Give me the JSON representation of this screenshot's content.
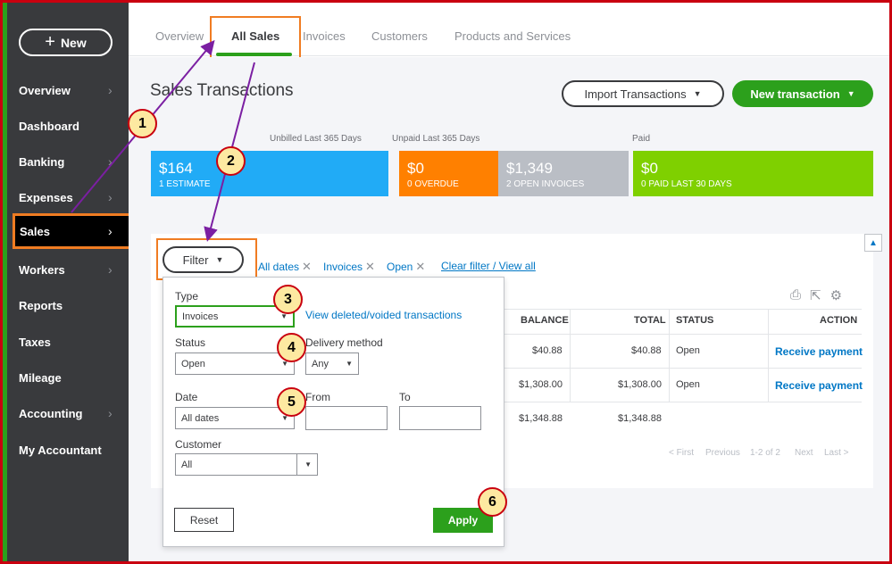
{
  "sidebar": {
    "new_label": "New",
    "items": [
      {
        "label": "Overview",
        "has_chevron": true
      },
      {
        "label": "Dashboard",
        "has_chevron": false
      },
      {
        "label": "Banking",
        "has_chevron": true
      },
      {
        "label": "Expenses",
        "has_chevron": true
      },
      {
        "label": "Sales",
        "has_chevron": true,
        "active": true
      },
      {
        "label": "Workers",
        "has_chevron": true
      },
      {
        "label": "Reports",
        "has_chevron": false
      },
      {
        "label": "Taxes",
        "has_chevron": false
      },
      {
        "label": "Mileage",
        "has_chevron": false
      },
      {
        "label": "Accounting",
        "has_chevron": true
      },
      {
        "label": "My Accountant",
        "has_chevron": false
      }
    ]
  },
  "tabs": [
    "Overview",
    "All Sales",
    "Invoices",
    "Customers",
    "Products and Services"
  ],
  "active_tab": "All Sales",
  "page": {
    "title": "Sales Transactions",
    "import_label": "Import Transactions",
    "new_transaction_label": "New transaction"
  },
  "money_bar": {
    "unbilled_label": "Unbilled Last 365 Days",
    "unpaid_label": "Unpaid Last 365 Days",
    "paid_label": "Paid",
    "estimate": {
      "amount": "$164",
      "sub": "1 ESTIMATE",
      "color": "#21abf6"
    },
    "overdue": {
      "amount": "$0",
      "sub": "0 OVERDUE",
      "color": "#ff8000"
    },
    "open_invoices": {
      "amount": "$1,349",
      "sub": "2 OPEN INVOICES",
      "color": "#babec5"
    },
    "paid": {
      "amount": "$0",
      "sub": "0 PAID LAST 30 DAYS",
      "color": "#7fd000"
    }
  },
  "filter_bar": {
    "filter_label": "Filter",
    "chips": [
      "All dates",
      "Invoices",
      "Open"
    ],
    "clear_label": "Clear filter / View all"
  },
  "filter_panel": {
    "type_label": "Type",
    "type_value": "Invoices",
    "view_deleted_label": "View deleted/voided transactions",
    "status_label": "Status",
    "status_value": "Open",
    "delivery_label": "Delivery method",
    "delivery_value": "Any",
    "date_label": "Date",
    "date_value": "All dates",
    "from_label": "From",
    "to_label": "To",
    "customer_label": "Customer",
    "customer_value": "All",
    "reset_label": "Reset",
    "apply_label": "Apply"
  },
  "table": {
    "headers": {
      "balance": "BALANCE",
      "total": "TOTAL",
      "status": "STATUS",
      "action": "ACTION"
    },
    "rows": [
      {
        "balance": "$40.88",
        "total": "$40.88",
        "status": "Open",
        "action": "Receive payment"
      },
      {
        "balance": "$1,308.00",
        "total": "$1,308.00",
        "status": "Open",
        "action": "Receive payment"
      }
    ],
    "totals": {
      "balance": "$1,348.88",
      "total": "$1,348.88"
    },
    "pagination": {
      "first": "< First",
      "previous": "Previous",
      "range": "1-2 of 2",
      "next": "Next",
      "last": "Last >"
    }
  },
  "annotations": [
    "1",
    "2",
    "3",
    "4",
    "5",
    "6"
  ],
  "colors": {
    "brand_green": "#2ca01c",
    "highlight_orange": "#f07c22",
    "arrow_purple": "#7b1fa2",
    "frame_red": "#c9000f",
    "link_blue": "#0077c5"
  }
}
